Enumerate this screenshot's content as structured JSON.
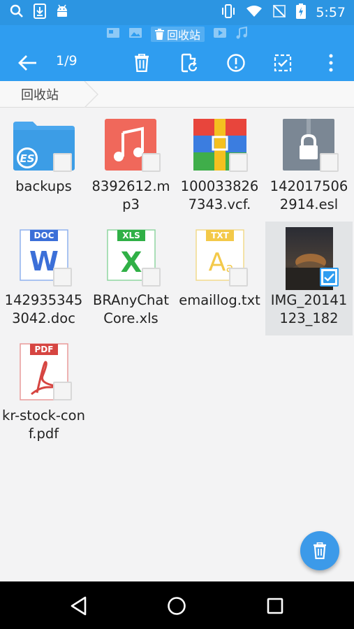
{
  "status_bar": {
    "time": "5:57",
    "left_icons": [
      "search-icon",
      "download-icon",
      "android-icon"
    ],
    "right_icons": [
      "vibrate-icon",
      "wifi-icon",
      "no-signal-icon",
      "battery-charging-icon"
    ]
  },
  "subtabs": {
    "active_label": "回收站",
    "icons": [
      "image-icon",
      "photo-icon",
      "trash-icon",
      "video-icon",
      "music-icon"
    ]
  },
  "toolbar": {
    "counter": "1/9",
    "buttons": [
      "back-arrow-icon",
      "delete-icon",
      "restore-icon",
      "info-icon",
      "select-all-icon",
      "more-icon"
    ]
  },
  "breadcrumb": {
    "label": "回收站"
  },
  "files": [
    {
      "name": "backups",
      "type": "folder",
      "selected": false
    },
    {
      "name": "8392612.mp3",
      "type": "audio",
      "selected": false
    },
    {
      "name": "1000338267343.vcf.",
      "type": "archive",
      "selected": false
    },
    {
      "name": "1420175062914.esl",
      "type": "locked",
      "selected": false
    },
    {
      "name": "1429353453042.doc",
      "type": "doc",
      "selected": false
    },
    {
      "name": "BRAnyChatCore.xls",
      "type": "xls",
      "selected": false
    },
    {
      "name": "emaillog.txt",
      "type": "txt",
      "selected": false
    },
    {
      "name": "IMG_20141123_182",
      "type": "image",
      "selected": true
    },
    {
      "name": "kr-stock-conf.pdf",
      "type": "pdf",
      "selected": false
    }
  ],
  "icon_labels": {
    "doc": "DOC",
    "xls": "XLS",
    "txt": "TXT",
    "pdf": "PDF",
    "es": "ES"
  },
  "colors": {
    "status_bar": "#2c95e2",
    "app_bar": "#2f9df0",
    "fab": "#3c9ae9",
    "selected_bg": "#e2e4e6"
  }
}
